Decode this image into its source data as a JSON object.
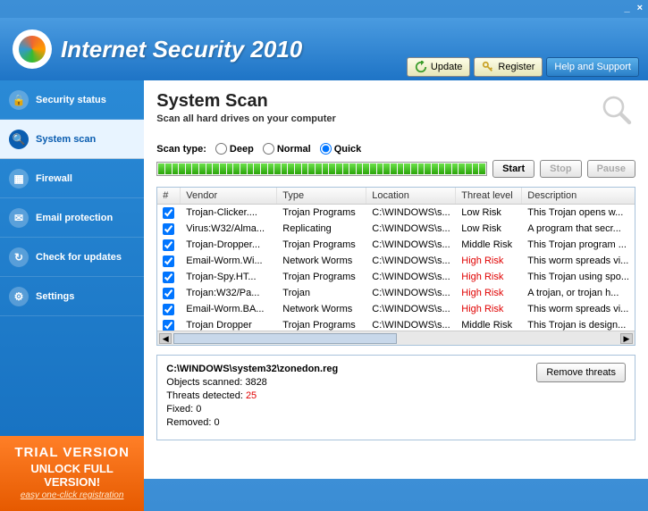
{
  "window": {
    "minimize": "_",
    "close": "×"
  },
  "app": {
    "title": "Internet Security 2010"
  },
  "topbuttons": {
    "update": "Update",
    "register": "Register",
    "help": "Help and Support"
  },
  "sidebar": {
    "items": [
      {
        "label": "Security status",
        "icon": "🔒"
      },
      {
        "label": "System scan",
        "icon": "🔍"
      },
      {
        "label": "Firewall",
        "icon": "▦"
      },
      {
        "label": "Email protection",
        "icon": "✉"
      },
      {
        "label": "Check for updates",
        "icon": "↻"
      },
      {
        "label": "Settings",
        "icon": "⚙"
      }
    ]
  },
  "trial": {
    "line1": "TRIAL VERSION",
    "line2": "UNLOCK FULL VERSION!",
    "line3": "easy one-click registration"
  },
  "panel": {
    "title": "System Scan",
    "subtitle": "Scan all hard drives on your computer"
  },
  "scan": {
    "type_label": "Scan type:",
    "deep": "Deep",
    "normal": "Normal",
    "quick": "Quick",
    "start": "Start",
    "stop": "Stop",
    "pause": "Pause"
  },
  "gridhead": {
    "num": "#",
    "vendor": "Vendor",
    "type": "Type",
    "location": "Location",
    "threat": "Threat level",
    "desc": "Description"
  },
  "rows": [
    {
      "vendor": "Trojan-Clicker....",
      "type": "Trojan Programs",
      "location": "C:\\WINDOWS\\s...",
      "threat": "Low Risk",
      "high": false,
      "desc": "This Trojan opens w..."
    },
    {
      "vendor": "Virus:W32/Alma...",
      "type": "Replicating",
      "location": "C:\\WINDOWS\\s...",
      "threat": "Low Risk",
      "high": false,
      "desc": "A program that secr..."
    },
    {
      "vendor": "Trojan-Dropper...",
      "type": "Trojan Programs",
      "location": "C:\\WINDOWS\\s...",
      "threat": "Middle Risk",
      "high": false,
      "desc": "This Trojan program ..."
    },
    {
      "vendor": "Email-Worm.Wi...",
      "type": "Network Worms",
      "location": "C:\\WINDOWS\\s...",
      "threat": "High Risk",
      "high": true,
      "desc": "This worm spreads vi..."
    },
    {
      "vendor": "Trojan-Spy.HT...",
      "type": "Trojan Programs",
      "location": "C:\\WINDOWS\\s...",
      "threat": "High Risk",
      "high": true,
      "desc": "This Trojan using spo..."
    },
    {
      "vendor": "Trojan:W32/Pa...",
      "type": "Trojan",
      "location": "C:\\WINDOWS\\s...",
      "threat": "High Risk",
      "high": true,
      "desc": "A trojan, or trojan h..."
    },
    {
      "vendor": "Email-Worm.BA...",
      "type": "Network Worms",
      "location": "C:\\WINDOWS\\s...",
      "threat": "High Risk",
      "high": true,
      "desc": "This worm spreads vi..."
    },
    {
      "vendor": "Trojan Dropper",
      "type": "Trojan Programs",
      "location": "C:\\WINDOWS\\s...",
      "threat": "Middle Risk",
      "high": false,
      "desc": "This Trojan is design..."
    }
  ],
  "summary": {
    "path": "C:\\WINDOWS\\system32\\zonedon.reg",
    "scanned_label": "Objects scanned:",
    "scanned": "3828",
    "detected_label": "Threats detected:",
    "detected": "25",
    "fixed_label": "Fixed:",
    "fixed": "0",
    "removed_label": "Removed:",
    "removed": "0",
    "remove_btn": "Remove threats"
  }
}
